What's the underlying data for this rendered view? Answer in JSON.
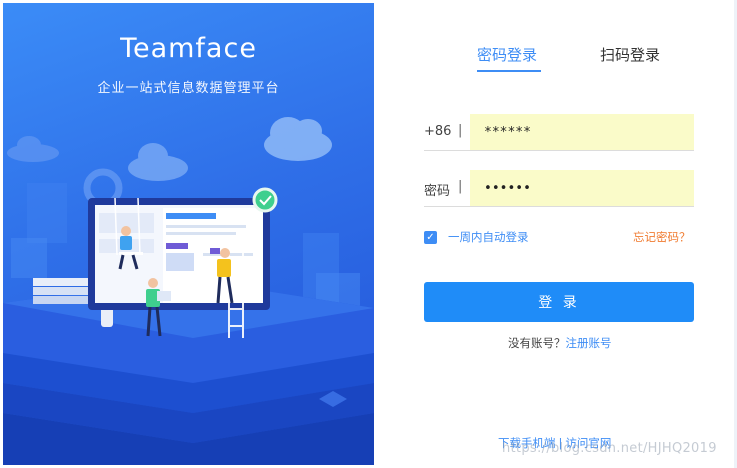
{
  "brand": {
    "title": "Teamface",
    "subtitle": "企业一站式信息数据管理平台"
  },
  "tabs": [
    {
      "label": "密码登录",
      "active": true
    },
    {
      "label": "扫码登录",
      "active": false
    }
  ],
  "phone_field": {
    "prefix": "+86",
    "separator": "|",
    "value": "******"
  },
  "password_field": {
    "prefix": "密码",
    "separator": "|",
    "value": "••••••"
  },
  "remember": {
    "checked": true,
    "check_glyph": "✓",
    "label": "一周内自动登录"
  },
  "forgot_label": "忘记密码？",
  "login_button": "登 录",
  "register": {
    "prompt": "没有账号？",
    "link": "注册账号"
  },
  "footer": {
    "download": "下载手机端",
    "separator": "|",
    "visit": "访问官网"
  },
  "watermark": "https://blog.csdn.net/HJHQ2019",
  "colors": {
    "accent": "#3e8df5",
    "button": "#1f8cf8",
    "forgot": "#f07b30",
    "input_autofill": "#fafbc9",
    "panel_blue": "#2f6fe8"
  }
}
